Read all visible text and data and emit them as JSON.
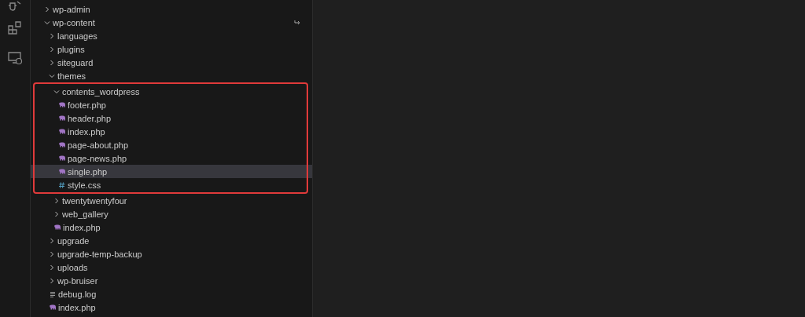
{
  "tree": [
    {
      "kind": "folder",
      "name": "wp-admin",
      "expanded": false,
      "selected": false
    },
    {
      "kind": "folder",
      "name": "wp-content",
      "expanded": true,
      "selected": false,
      "action": true,
      "children": [
        {
          "kind": "folder",
          "name": "languages",
          "expanded": false,
          "selected": false
        },
        {
          "kind": "folder",
          "name": "plugins",
          "expanded": false,
          "selected": false
        },
        {
          "kind": "folder",
          "name": "siteguard",
          "expanded": false,
          "selected": false
        },
        {
          "kind": "folder",
          "name": "themes",
          "expanded": true,
          "selected": false,
          "children": [
            {
              "kind": "folder",
              "name": "contents_wordpress",
              "expanded": true,
              "selected": false,
              "highlighted": true,
              "children": [
                {
                  "kind": "php",
                  "name": "footer.php",
                  "selected": false
                },
                {
                  "kind": "php",
                  "name": "header.php",
                  "selected": false
                },
                {
                  "kind": "php",
                  "name": "index.php",
                  "selected": false
                },
                {
                  "kind": "php",
                  "name": "page-about.php",
                  "selected": false
                },
                {
                  "kind": "php",
                  "name": "page-news.php",
                  "selected": false
                },
                {
                  "kind": "php",
                  "name": "single.php",
                  "selected": true
                },
                {
                  "kind": "css",
                  "name": "style.css",
                  "selected": false
                }
              ]
            },
            {
              "kind": "folder",
              "name": "twentytwentyfour",
              "expanded": false,
              "selected": false
            },
            {
              "kind": "folder",
              "name": "web_gallery",
              "expanded": false,
              "selected": false
            },
            {
              "kind": "php",
              "name": "index.php",
              "selected": false
            }
          ]
        },
        {
          "kind": "folder",
          "name": "upgrade",
          "expanded": false,
          "selected": false
        },
        {
          "kind": "folder",
          "name": "upgrade-temp-backup",
          "expanded": false,
          "selected": false
        },
        {
          "kind": "folder",
          "name": "uploads",
          "expanded": false,
          "selected": false
        },
        {
          "kind": "folder",
          "name": "wp-bruiser",
          "expanded": false,
          "selected": false
        },
        {
          "kind": "log",
          "name": "debug.log",
          "selected": false
        },
        {
          "kind": "php",
          "name": "index.php",
          "selected": false
        }
      ]
    }
  ]
}
